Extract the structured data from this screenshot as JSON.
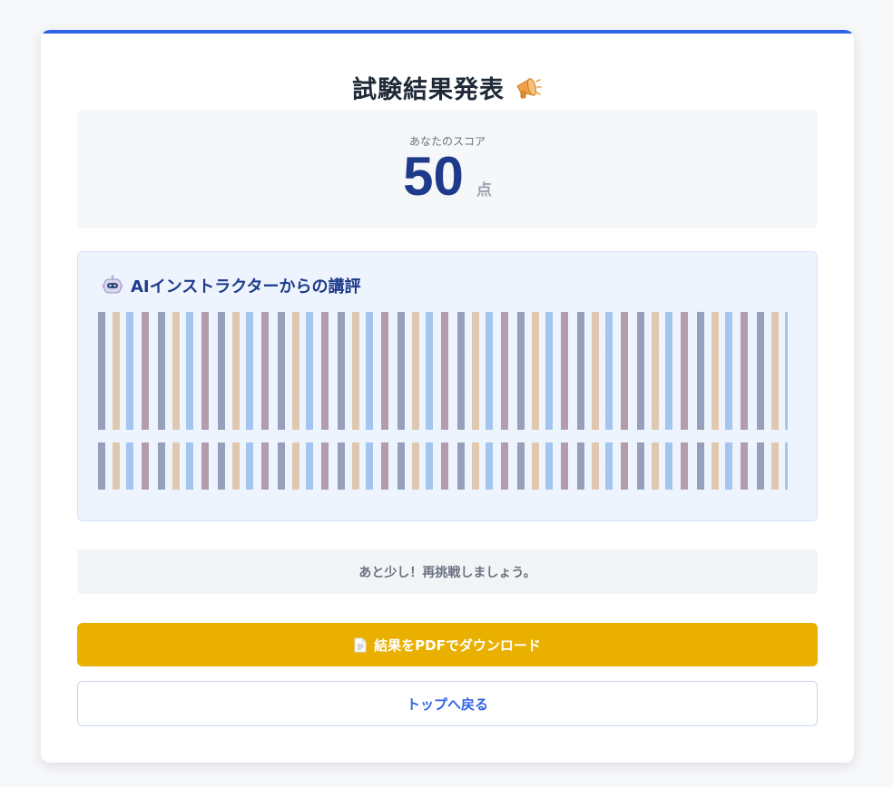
{
  "header": {
    "title": "試験結果発表",
    "title_icon": "megaphone-icon"
  },
  "score": {
    "label": "あなたのスコア",
    "value": "50",
    "unit": "点"
  },
  "feedback": {
    "heading": "AIインストラクターからの講評",
    "heading_icon": "robot-icon",
    "paragraphs": [
      "",
      ""
    ]
  },
  "message": {
    "text": "あと少し！再挑戦しましょう。"
  },
  "actions": {
    "download_label": "結果をPDFでダウンロード",
    "download_icon": "document-icon",
    "back_label": "トップへ戻る"
  },
  "colors": {
    "accent": "#2f63e6",
    "score": "#1e3a8a",
    "download_button": "#eab000",
    "feedback_bg": "#eef4fe"
  }
}
